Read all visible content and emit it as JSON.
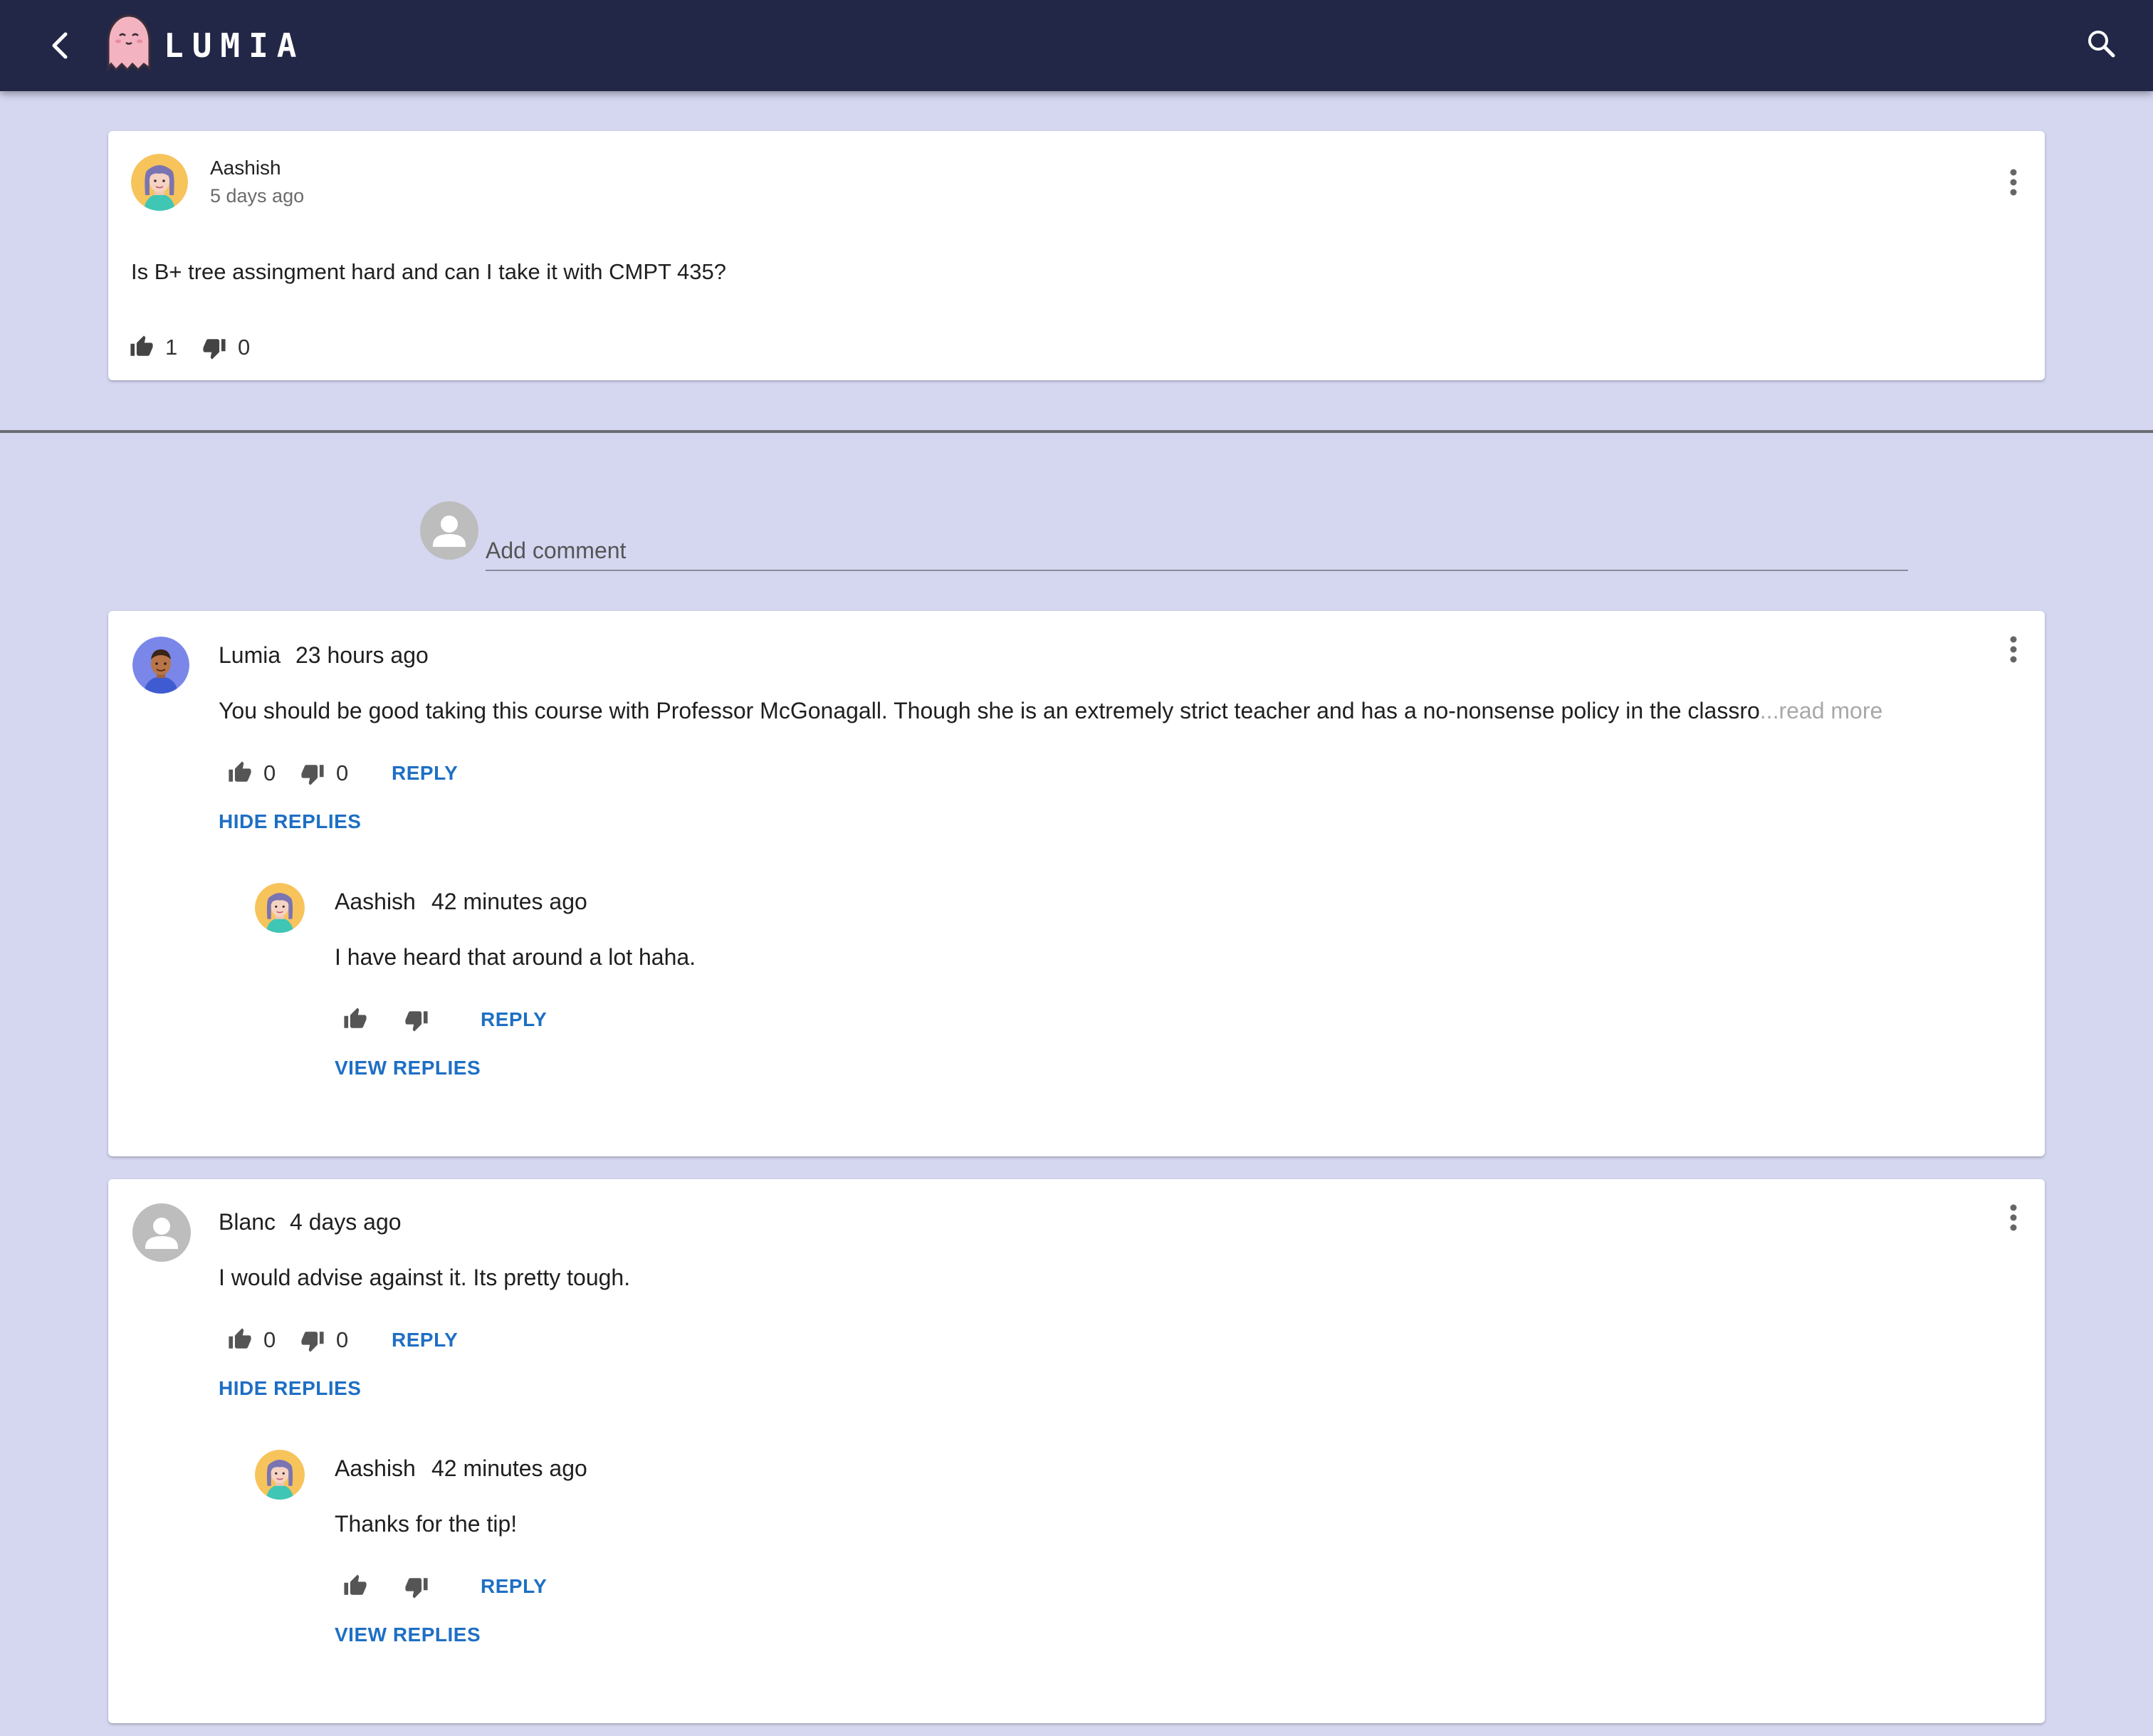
{
  "app": {
    "brand": "LUMIA"
  },
  "post": {
    "author": "Aashish",
    "time": "5 days ago",
    "body": "Is B+ tree assingment hard and can I take it with CMPT 435?",
    "likes": "1",
    "dislikes": "0"
  },
  "add_comment": {
    "placeholder": "Add comment"
  },
  "comments": [
    {
      "author": "Lumia",
      "time": "23 hours ago",
      "body": "You should be good taking this course with Professor McGonagall. Though she is an extremely strict teacher and has a no-nonsense policy in the classro",
      "read_more": "...read more",
      "likes": "0",
      "dislikes": "0",
      "reply_label": "REPLY",
      "toggle_label": "HIDE REPLIES",
      "replies": [
        {
          "author": "Aashish",
          "time": "42 minutes ago",
          "body": "I have heard that around a lot haha.",
          "reply_label": "REPLY",
          "view_label": "VIEW REPLIES"
        }
      ]
    },
    {
      "author": "Blanc",
      "time": "4 days ago",
      "body": "I would advise against it. Its pretty tough.",
      "likes": "0",
      "dislikes": "0",
      "reply_label": "REPLY",
      "toggle_label": "HIDE REPLIES",
      "replies": [
        {
          "author": "Aashish",
          "time": "42 minutes ago",
          "body": "Thanks for the tip!",
          "reply_label": "REPLY",
          "view_label": "VIEW REPLIES"
        }
      ]
    }
  ],
  "colors": {
    "appbar": "#232747",
    "background": "#d5d7f1",
    "link": "#1e6fc4",
    "muted": "#a8a8a8"
  },
  "icons": [
    "back-arrow-icon",
    "ghost-logo-icon",
    "search-icon",
    "more-vert-icon",
    "thumb-up-icon",
    "thumb-down-icon",
    "person-icon"
  ]
}
